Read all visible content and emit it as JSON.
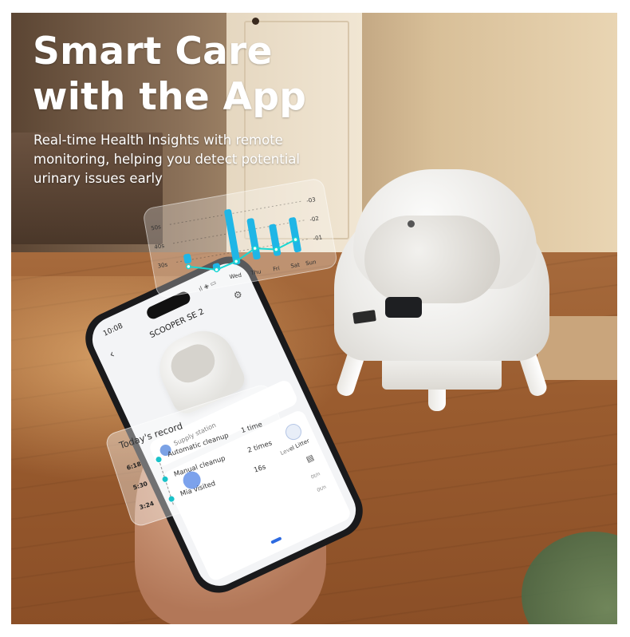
{
  "headline": {
    "line1": "Smart Care",
    "line2": "with the App",
    "subtitle_line1": "Real-time Health Insights with remote",
    "subtitle_line2": "monitoring, helping you detect potential",
    "subtitle_line3": "urinary issues early"
  },
  "weekly_chart": {
    "y_left": [
      "50s",
      "40s",
      "30s"
    ],
    "y_right": [
      "-03",
      "-02",
      "-01"
    ],
    "days": [
      "Wed",
      "Thu",
      "Fri",
      "Sat",
      "Sun"
    ],
    "colors": {
      "bars": "#1fb6e6",
      "line": "#18d7d2"
    }
  },
  "phone": {
    "status_time": "10:08",
    "status_icons": "ıl ◈ ▭",
    "device_title": "SCOOPER SE 2",
    "supply_station": "Supply station",
    "level_litter": "Level Litter",
    "mini_labels": [
      "0t/n",
      "0t/n"
    ]
  },
  "todays_record": {
    "title": "Today's record",
    "rows": [
      {
        "time": "6:18",
        "event": "Automatic cleanup",
        "value": "1 time"
      },
      {
        "time": "5:30",
        "event": "Manual cleanup",
        "value": "2 times"
      },
      {
        "time": "3:24",
        "event": "Mia visited",
        "value": "16s"
      }
    ]
  },
  "brand_colors": {
    "accent": "#19c2c9",
    "app_blue": "#2d6ae0"
  }
}
